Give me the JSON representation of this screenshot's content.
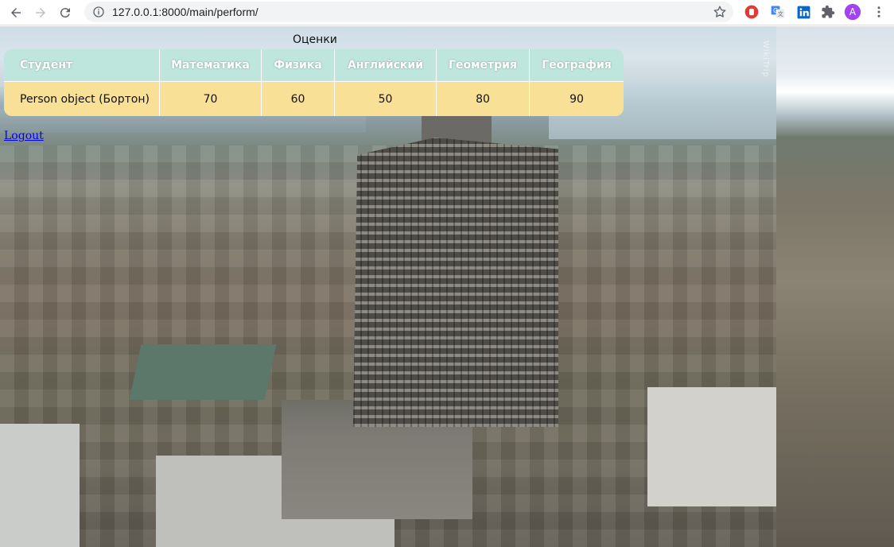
{
  "browser": {
    "url": "127.0.0.1:8000/main/perform/",
    "avatar_letter": "A",
    "colors": {
      "avatar": "#a142f4",
      "red_ext": "#e53935",
      "linkedin": "#0a66c2"
    }
  },
  "page": {
    "title": "Оценки",
    "watermark": "WikiTrip",
    "table": {
      "headers": [
        "Студент",
        "Математика",
        "Физика",
        "Английский",
        "Геометрия",
        "География"
      ],
      "rows": [
        [
          "Person object (Бортон)",
          "70",
          "60",
          "50",
          "80",
          "90"
        ]
      ]
    },
    "logout_label": "Logout",
    "colors": {
      "header_bg": "#bfe6dc",
      "row_bg": "#f8e196",
      "link": "#0000ee"
    }
  }
}
